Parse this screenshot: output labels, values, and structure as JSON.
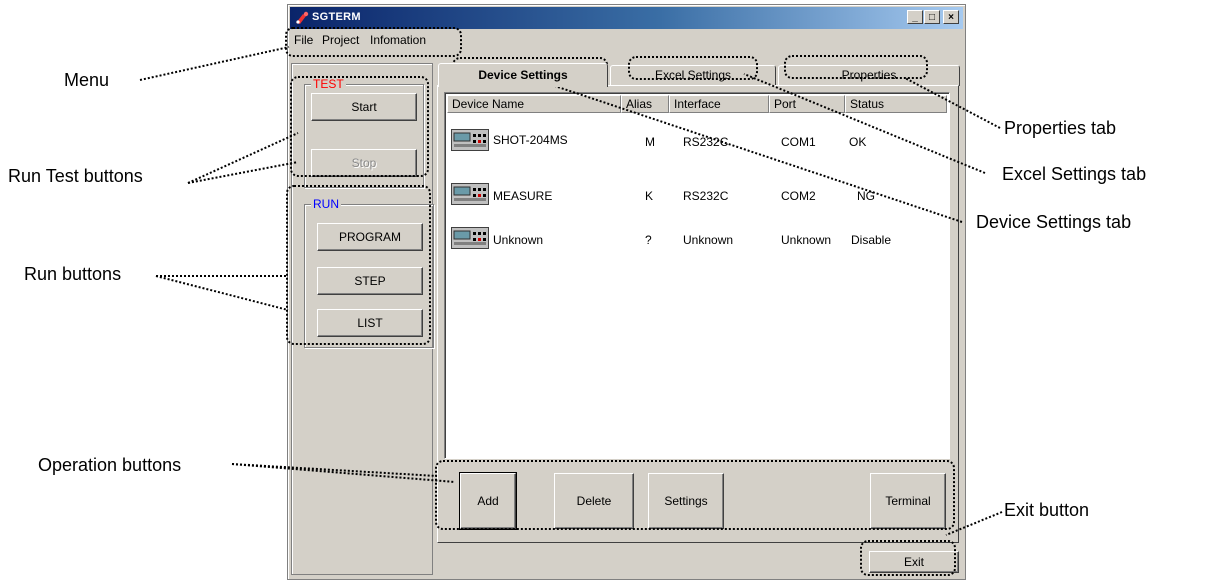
{
  "window": {
    "title": "SGTERM",
    "menu": [
      "File",
      "Project",
      "Infomation"
    ],
    "min_icon": "_",
    "max_icon": "□",
    "close_icon": "×"
  },
  "test_group": {
    "title": "TEST",
    "title_color": "#ff0000",
    "start_label": "Start",
    "stop_label": "Stop"
  },
  "run_group": {
    "title": "RUN",
    "title_color": "#0000ff",
    "program_label": "PROGRAM",
    "step_label": "STEP",
    "list_label": "LIST"
  },
  "tabs": [
    "Device Settings",
    "Excel Settings",
    "Properties"
  ],
  "active_tab": "Device Settings",
  "device_table": {
    "columns": [
      "Device Name",
      "Alias",
      "Interface",
      "Port",
      "Status"
    ],
    "rows": [
      {
        "name": "SHOT-204MS",
        "alias": "M",
        "interface": "RS232C",
        "port": "COM1",
        "status": "OK"
      },
      {
        "name": "MEASURE",
        "alias": "K",
        "interface": "RS232C",
        "port": "COM2",
        "status": "NG"
      },
      {
        "name": "Unknown",
        "alias": "?",
        "interface": "Unknown",
        "port": "Unknown",
        "status": "Disable"
      }
    ]
  },
  "operations": {
    "add_label": "Add",
    "delete_label": "Delete",
    "settings_label": "Settings",
    "terminal_label": "Terminal"
  },
  "exit_label": "Exit",
  "annotations": {
    "menu": "Menu",
    "run_test_buttons": "Run Test buttons",
    "run_buttons": "Run buttons",
    "operation_buttons": "Operation buttons",
    "properties_tab": "Properties tab",
    "excel_settings_tab": "Excel Settings tab",
    "device_settings_tab": "Device Settings tab",
    "exit_button": "Exit button"
  }
}
